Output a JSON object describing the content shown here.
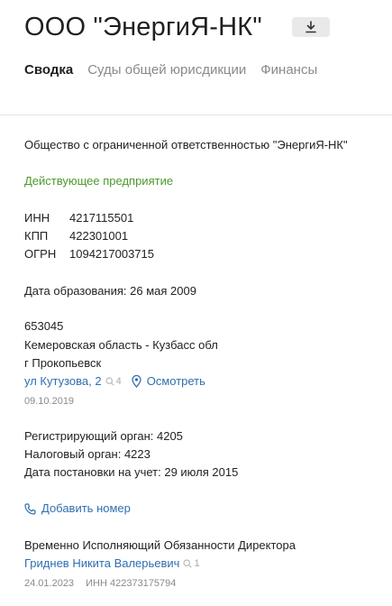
{
  "header": {
    "company_name": "ООО \"ЭнергиЯ-НК\"",
    "download_icon": "download-icon"
  },
  "tabs": [
    {
      "label": "Сводка",
      "active": true
    },
    {
      "label": "Суды общей юрисдикции",
      "active": false
    },
    {
      "label": "Финансы",
      "active": false
    }
  ],
  "summary": {
    "full_name": "Общество с ограниченной ответственностью \"ЭнергиЯ-НК\"",
    "status": "Действующее предприятие",
    "inn_label": "ИНН",
    "inn_value": "4217115501",
    "kpp_label": "КПП",
    "kpp_value": "422301001",
    "ogrn_label": "ОГРН",
    "ogrn_value": "1094217003715",
    "founded": "Дата образования: 26 мая 2009",
    "address": {
      "postcode": "653045",
      "region": "Кемеровская область - Кузбасс обл",
      "city": "г Прокопьевск",
      "street_link": "ул Кутузова, 2",
      "street_count": "4",
      "view_link": "Осмотреть",
      "date": "09.10.2019"
    },
    "registration": {
      "registering_body": "Регистрирующий орган: 4205",
      "tax_body": "Налоговый орган: 4223",
      "tax_date": "Дата постановки на учет: 29 июля 2015"
    },
    "add_phone": "Добавить номер",
    "director": {
      "position": "Временно Исполняющий Обязанности Директора",
      "name_link": "Гриднев Никита Валерьевич",
      "name_count": "1",
      "date": "24.01.2023",
      "inn": "ИНН 422373175794"
    }
  },
  "colors": {
    "status": "#4c9a2a",
    "link": "#2f6fb0"
  }
}
